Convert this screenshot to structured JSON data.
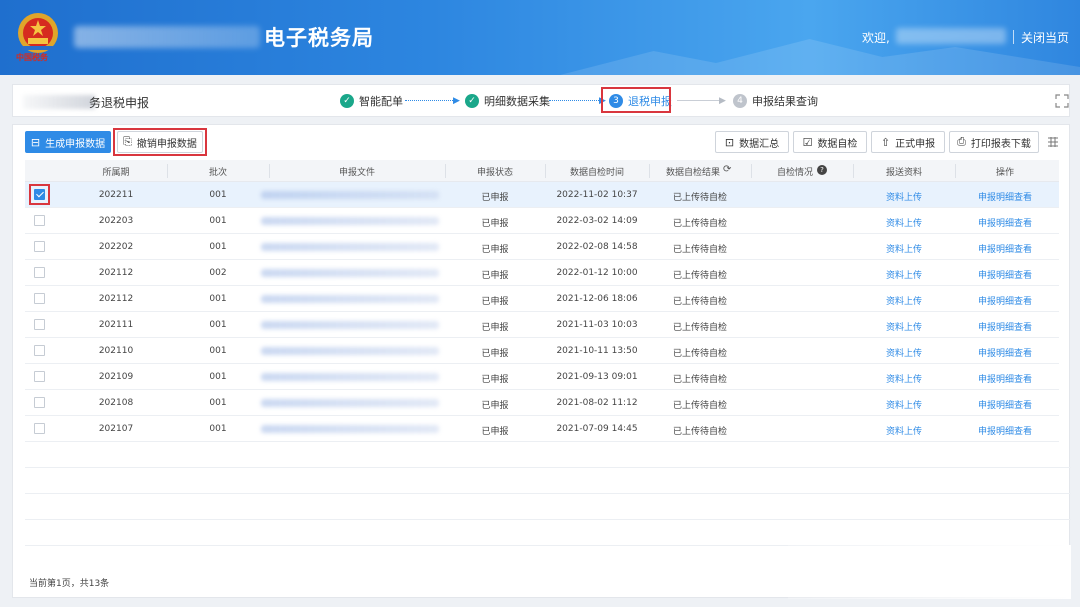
{
  "header": {
    "app_title": "电子税务局",
    "welcome": "欢迎,",
    "close_label": "关闭当页",
    "emblem_text": "中国税务"
  },
  "stepbar": {
    "crumb": "务退税申报",
    "steps": [
      {
        "label": "智能配单",
        "state": "done"
      },
      {
        "label": "明细数据采集",
        "state": "done"
      },
      {
        "label": "退税申报",
        "state": "current",
        "number": "3"
      },
      {
        "label": "申报结果查询",
        "state": "todo",
        "number": "4"
      }
    ]
  },
  "toolbar": {
    "generate": "生成申报数据",
    "revoke": "撤销申报数据",
    "summary": "数据汇总",
    "selfcheck": "数据自检",
    "formal": "正式申报",
    "print": "打印报表下载"
  },
  "table": {
    "headers": [
      "所属期",
      "批次",
      "申报文件",
      "申报状态",
      "数据自检时间",
      "数据自检结果",
      "自检情况",
      "报送资料",
      "操作"
    ],
    "rows": [
      {
        "period": "202211",
        "batch": "001",
        "status": "已申报",
        "time": "2022-11-02 10:37",
        "result": "已上传待自检",
        "upload": "资料上传",
        "action": "申报明细查看",
        "checked": true
      },
      {
        "period": "202203",
        "batch": "001",
        "status": "已申报",
        "time": "2022-03-02 14:09",
        "result": "已上传待自检",
        "upload": "资料上传",
        "action": "申报明细查看",
        "checked": false
      },
      {
        "period": "202202",
        "batch": "001",
        "status": "已申报",
        "time": "2022-02-08 14:58",
        "result": "已上传待自检",
        "upload": "资料上传",
        "action": "申报明细查看",
        "checked": false
      },
      {
        "period": "202112",
        "batch": "002",
        "status": "已申报",
        "time": "2022-01-12 10:00",
        "result": "已上传待自检",
        "upload": "资料上传",
        "action": "申报明细查看",
        "checked": false
      },
      {
        "period": "202112",
        "batch": "001",
        "status": "已申报",
        "time": "2021-12-06 18:06",
        "result": "已上传待自检",
        "upload": "资料上传",
        "action": "申报明细查看",
        "checked": false
      },
      {
        "period": "202111",
        "batch": "001",
        "status": "已申报",
        "time": "2021-11-03 10:03",
        "result": "已上传待自检",
        "upload": "资料上传",
        "action": "申报明细查看",
        "checked": false
      },
      {
        "period": "202110",
        "batch": "001",
        "status": "已申报",
        "time": "2021-10-11 13:50",
        "result": "已上传待自检",
        "upload": "资料上传",
        "action": "申报明细查看",
        "checked": false
      },
      {
        "period": "202109",
        "batch": "001",
        "status": "已申报",
        "time": "2021-09-13 09:01",
        "result": "已上传待自检",
        "upload": "资料上传",
        "action": "申报明细查看",
        "checked": false
      },
      {
        "period": "202108",
        "batch": "001",
        "status": "已申报",
        "time": "2021-08-02 11:12",
        "result": "已上传待自检",
        "upload": "资料上传",
        "action": "申报明细查看",
        "checked": false
      },
      {
        "period": "202107",
        "batch": "001",
        "status": "已申报",
        "time": "2021-07-09 14:45",
        "result": "已上传待自检",
        "upload": "资料上传",
        "action": "申报明细查看",
        "checked": false
      }
    ]
  },
  "footer": {
    "pagination": "当前第1页，共13条"
  },
  "colors": {
    "accent": "#2f8be6",
    "done": "#1aa78a",
    "highlight": "#d9363e"
  }
}
